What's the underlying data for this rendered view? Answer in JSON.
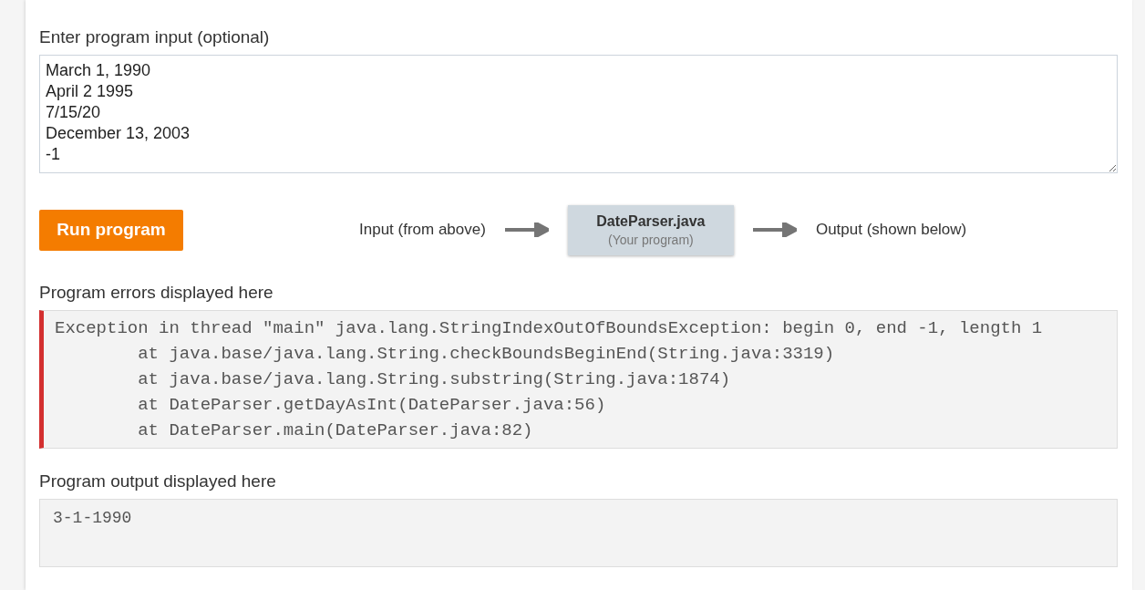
{
  "input_section": {
    "label": "Enter program input (optional)",
    "value": "March 1, 1990\nApril 2 1995\n7/15/20\nDecember 13, 2003\n-1"
  },
  "run_button": {
    "label": "Run program"
  },
  "flow": {
    "input_label": "Input (from above)",
    "program_name": "DateParser.java",
    "program_note": "(Your program)",
    "output_label": "Output (shown below)"
  },
  "errors": {
    "label": "Program errors displayed here",
    "lines": [
      "Exception in thread \"main\" java.lang.StringIndexOutOfBoundsException: begin 0, end -1, length 1",
      "        at java.base/java.lang.String.checkBoundsBeginEnd(String.java:3319)",
      "        at java.base/java.lang.String.substring(String.java:1874)",
      "        at DateParser.getDayAsInt(DateParser.java:56)",
      "        at DateParser.main(DateParser.java:82)"
    ]
  },
  "output": {
    "label": "Program output displayed here",
    "lines": [
      "3-1-1990"
    ]
  }
}
